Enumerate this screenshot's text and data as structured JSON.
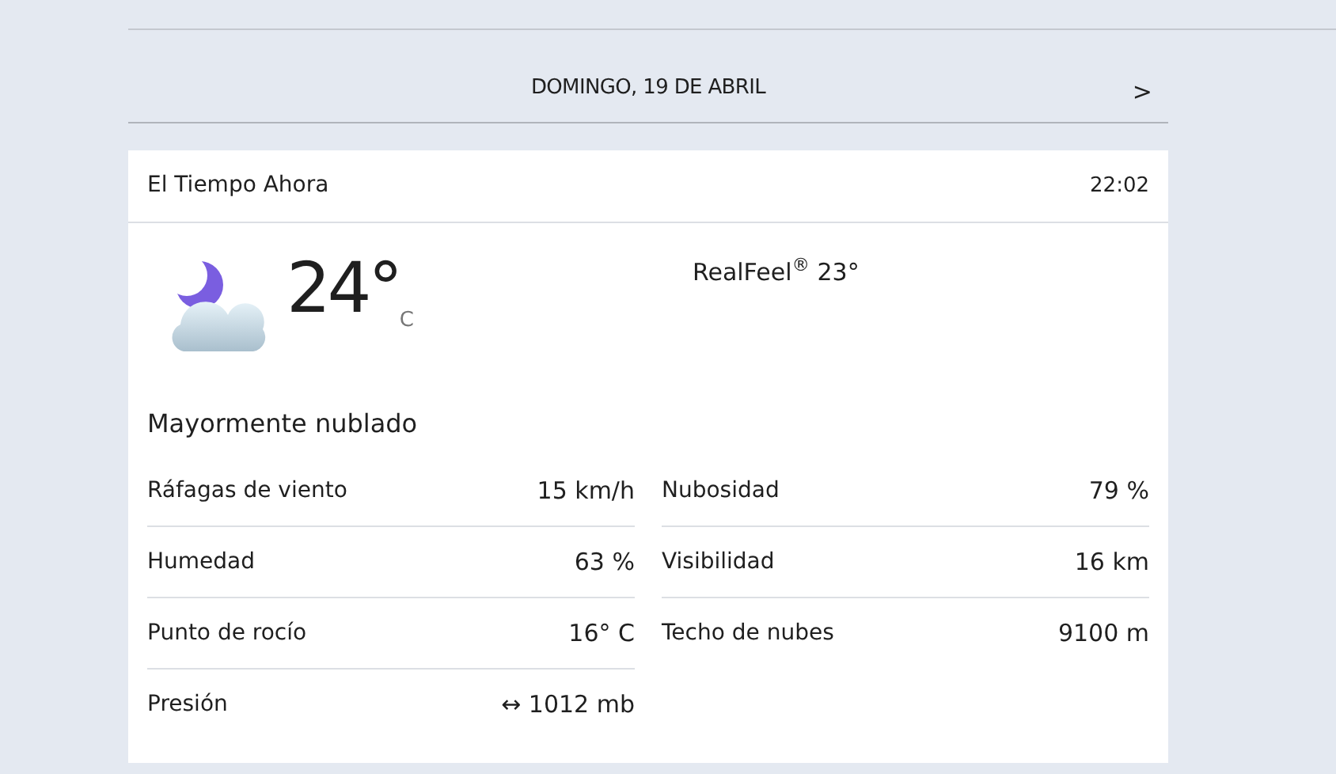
{
  "date_bar": {
    "label": "DOMINGO, 19 DE ABRIL",
    "next": ">"
  },
  "card": {
    "title": "El Tiempo Ahora",
    "time": "22:02",
    "temperature": "24°",
    "unit": "C",
    "realfeel": "RealFeel$^{®}$ 23°",
    "phrase": "Mayormente nublado",
    "details_left": [
      {
        "label": "Ráfagas de viento",
        "value": "15 km/h"
      },
      {
        "label": "Humedad",
        "value": "63 %"
      },
      {
        "label": "Punto de rocío",
        "value": "16° C"
      },
      {
        "label": "Presión",
        "value": "↔ 1012 mb"
      }
    ],
    "details_right": [
      {
        "label": "Nubosidad",
        "value": "79 %"
      },
      {
        "label": "Visibilidad",
        "value": "16 km"
      },
      {
        "label": "Techo de nubes",
        "value": "9100 m"
      }
    ]
  }
}
